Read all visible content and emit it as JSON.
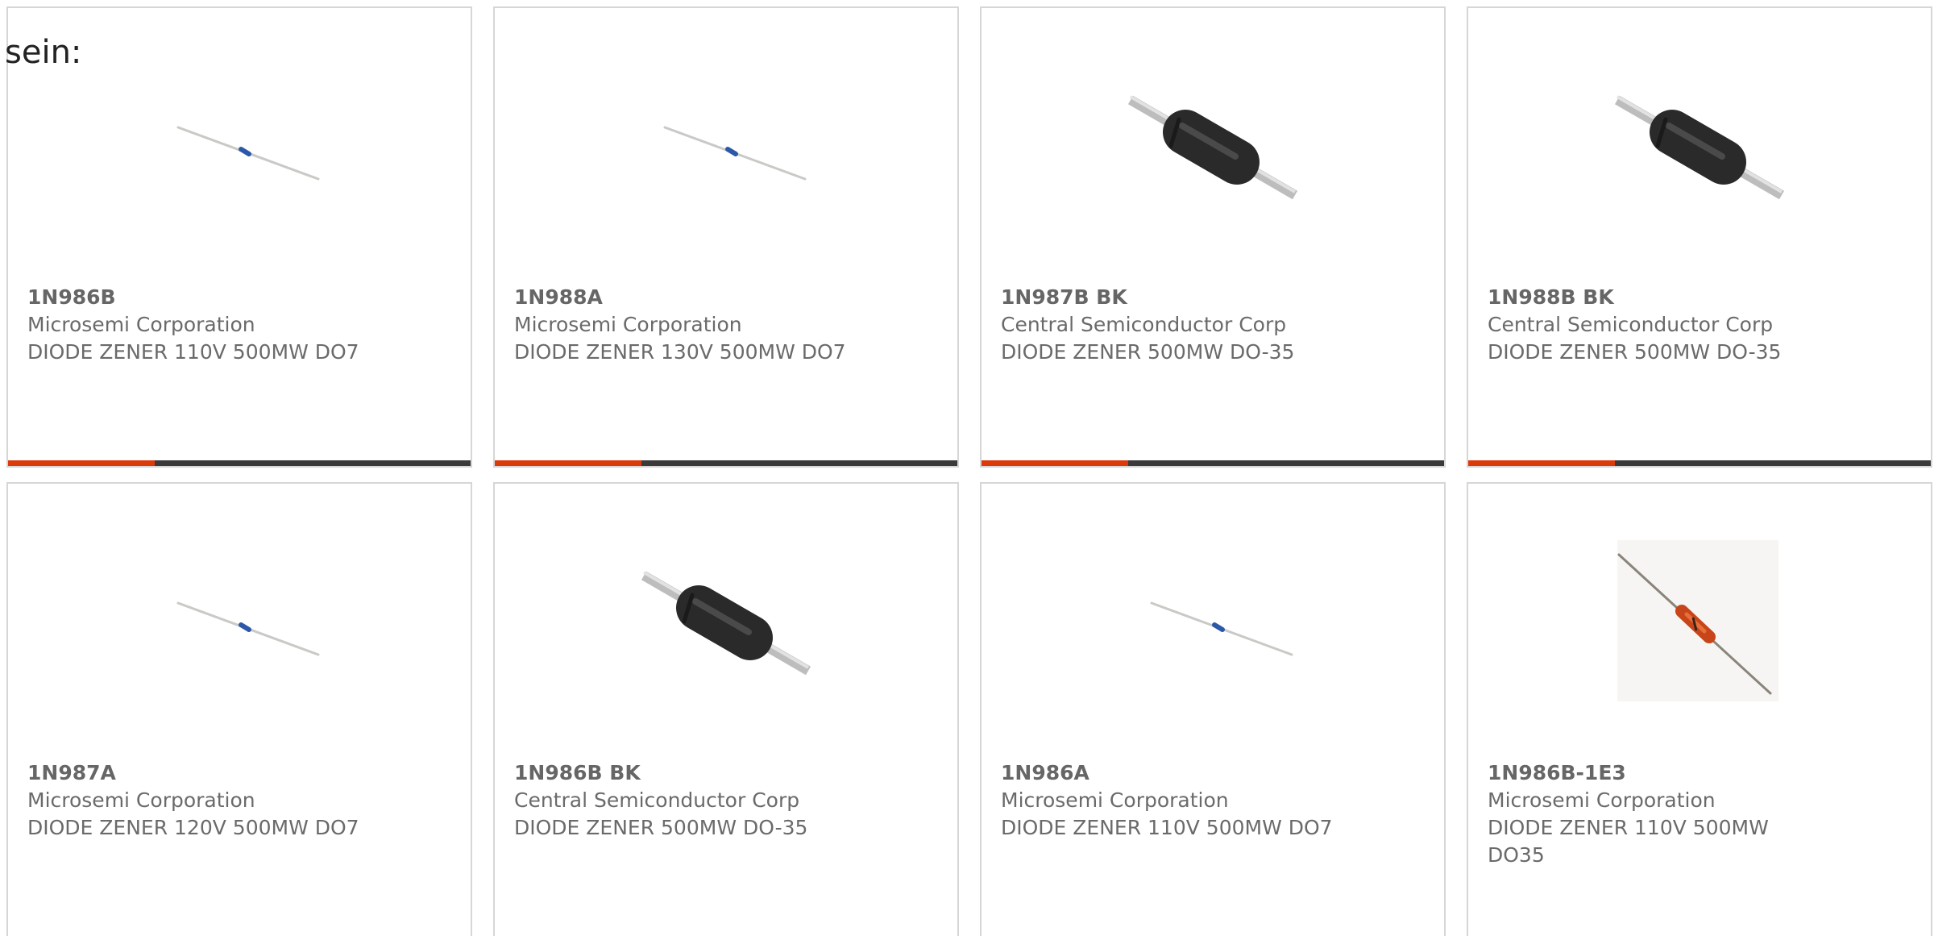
{
  "intro_text": "sein:",
  "colors": {
    "accent": "#dd3a0c",
    "bar": "#3a3a3a",
    "text": "#6a6a6a"
  },
  "products": [
    {
      "part_number": "1N986B",
      "manufacturer": "Microsemi Corporation",
      "description": "DIODE ZENER 110V 500MW DO7",
      "image": "axial-diode-blue-band-icon"
    },
    {
      "part_number": "1N988A",
      "manufacturer": "Microsemi Corporation",
      "description": "DIODE ZENER 130V 500MW DO7",
      "image": "axial-diode-blue-band-icon"
    },
    {
      "part_number": "1N987B BK",
      "manufacturer": "Central Semiconductor Corp",
      "description": "DIODE ZENER 500MW DO-35",
      "image": "black-cylinder-diode-icon"
    },
    {
      "part_number": "1N988B BK",
      "manufacturer": "Central Semiconductor Corp",
      "description": "DIODE ZENER 500MW DO-35",
      "image": "black-cylinder-diode-icon"
    },
    {
      "part_number": "1N987A",
      "manufacturer": "Microsemi Corporation",
      "description": "DIODE ZENER 120V 500MW DO7",
      "image": "axial-diode-blue-band-icon"
    },
    {
      "part_number": "1N986B BK",
      "manufacturer": "Central Semiconductor Corp",
      "description": "DIODE ZENER 500MW DO-35",
      "image": "black-cylinder-diode-icon"
    },
    {
      "part_number": "1N986A",
      "manufacturer": "Microsemi Corporation",
      "description": "DIODE ZENER 110V 500MW DO7",
      "image": "axial-diode-blue-band-icon"
    },
    {
      "part_number": "1N986B-1E3",
      "manufacturer": "Microsemi Corporation",
      "description": "DIODE ZENER 110V 500MW DO35",
      "image": "glass-diode-photo-icon"
    }
  ]
}
